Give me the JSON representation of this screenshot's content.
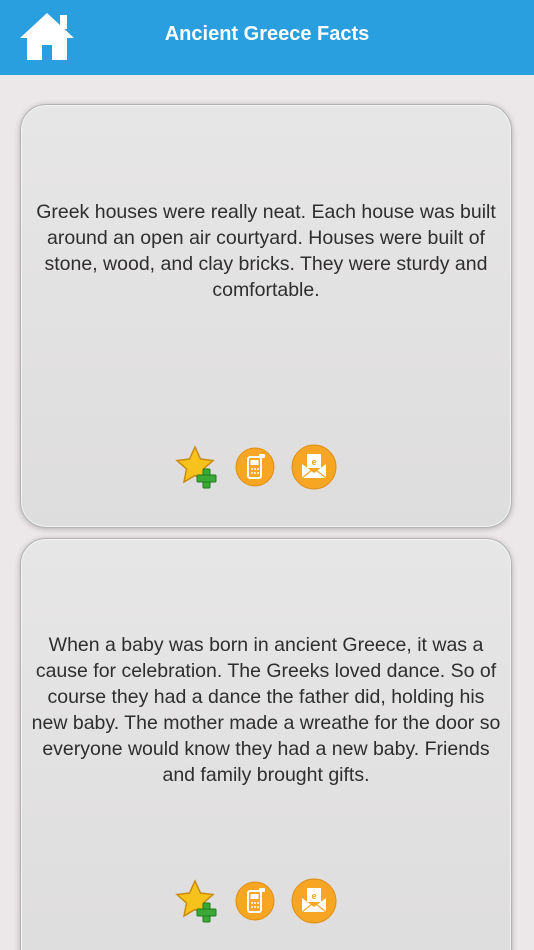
{
  "header": {
    "title": "Ancient Greece Facts",
    "home_icon": "home-icon",
    "background_color": "#2a9fe0"
  },
  "facts": [
    {
      "text": "Greek houses were really neat. Each house was built around an open air courtyard. Houses were built of stone, wood, and clay bricks. They were sturdy and comfortable.",
      "actions": [
        "favorite-add-icon",
        "sms-phone-icon",
        "email-icon"
      ]
    },
    {
      "text": "When a baby was born in ancient Greece, it was a cause for celebration. The Greeks loved dance. So of course they had a dance the father did, holding his new baby. The mother made a wreathe for the door so everyone would know they had a new baby. Friends and family brought gifts.",
      "actions": [
        "favorite-add-icon",
        "sms-phone-icon",
        "email-icon"
      ]
    }
  ],
  "colors": {
    "action_orange": "#f6a623",
    "star_yellow": "#f7c21c",
    "plus_green": "#3aa936"
  }
}
